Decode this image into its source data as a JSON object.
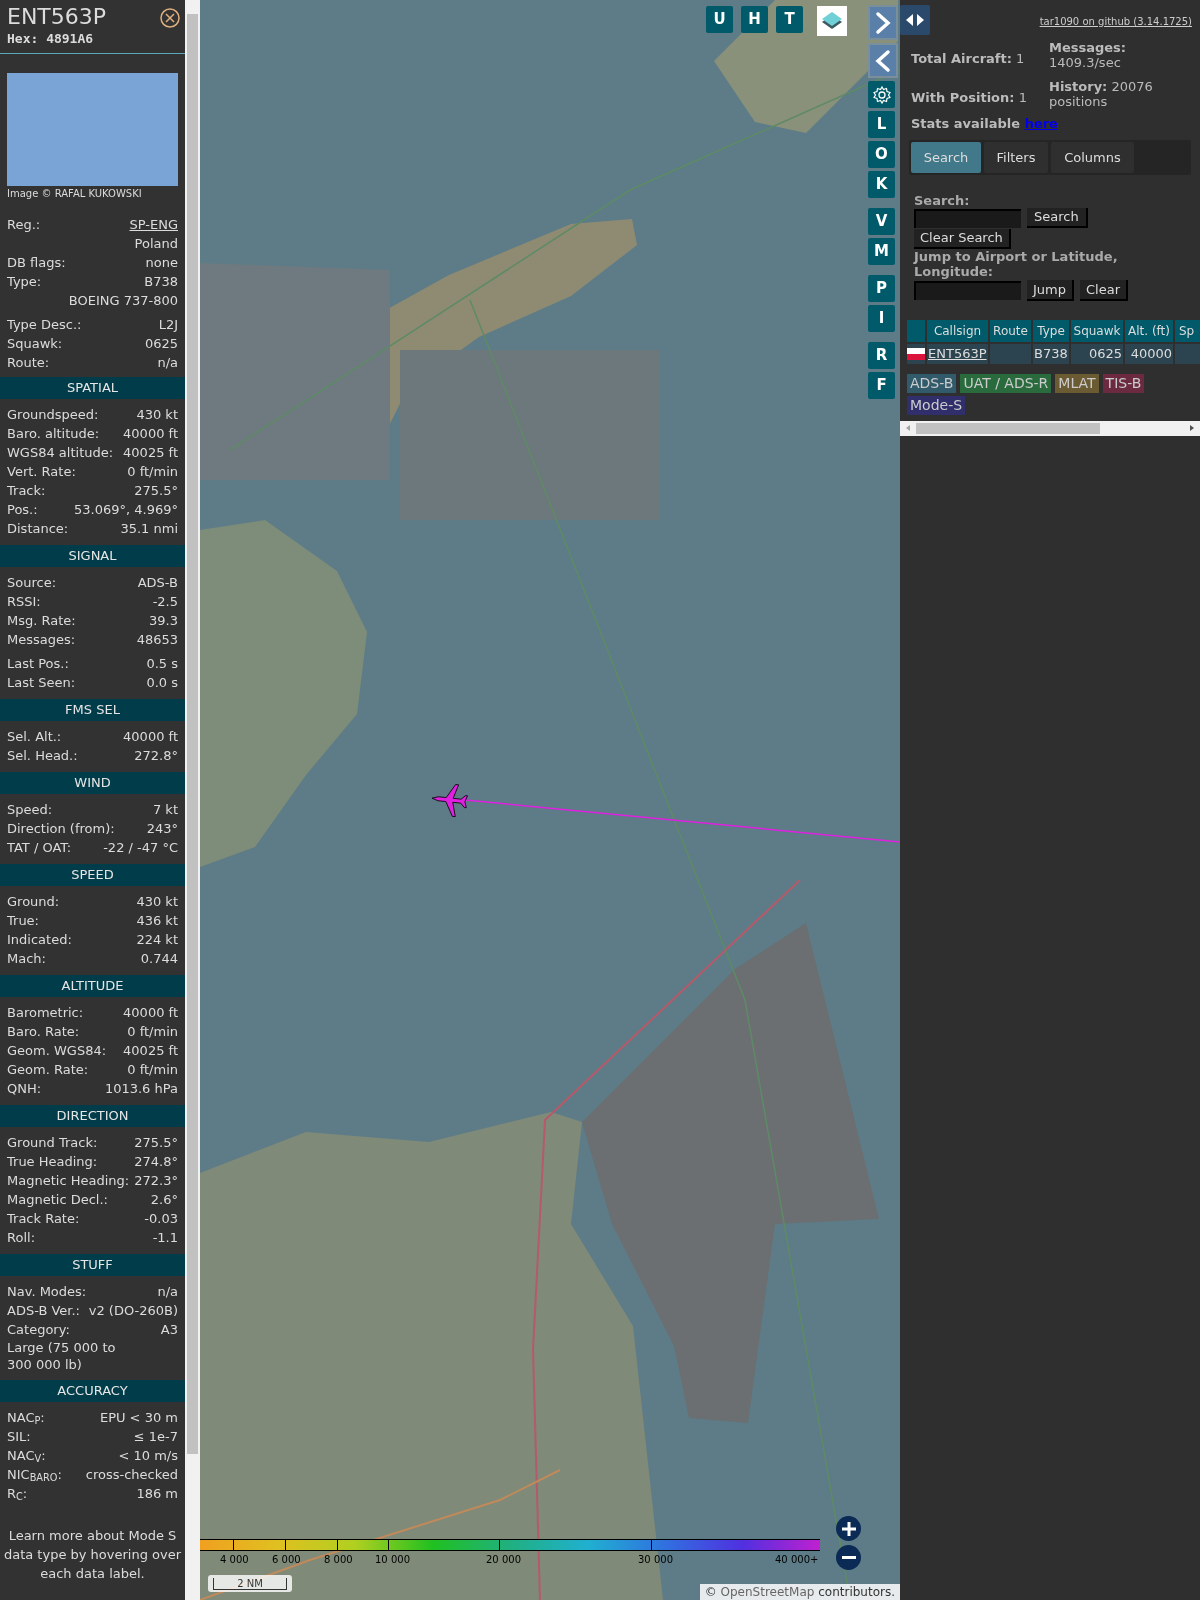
{
  "detail_panel": {
    "callsign": "ENT563P",
    "hex": "Hex: 4891A6",
    "photo_credit": "Image © RAFAL KUKOWSKI",
    "groups": [
      [
        {
          "kind": "link",
          "label": "Reg.:",
          "value": "SP-ENG"
        },
        {
          "kind": "value",
          "value": "Poland"
        },
        {
          "kind": "pair",
          "label": "DB flags:",
          "value": "none"
        },
        {
          "kind": "pair",
          "label": "Type:",
          "value": "B738"
        },
        {
          "kind": "value",
          "value": "BOEING 737-800"
        }
      ],
      [
        {
          "kind": "pair",
          "label": "Type Desc.:",
          "value": "L2J"
        },
        {
          "kind": "pair",
          "label": "Squawk:",
          "value": "0625"
        },
        {
          "kind": "pair",
          "label": "Route:",
          "value": "n/a"
        }
      ]
    ],
    "sections": [
      {
        "title": "SPATIAL",
        "groups": [
          [
            {
              "kind": "pair",
              "label": "Groundspeed:",
              "value": "430 kt"
            },
            {
              "kind": "pair",
              "label": "Baro. altitude:",
              "value": "40000 ft"
            },
            {
              "kind": "pair",
              "label": "WGS84 altitude:",
              "value": "40025 ft"
            },
            {
              "kind": "pair",
              "label": "Vert. Rate:",
              "value": "0 ft/min"
            },
            {
              "kind": "pair",
              "label": "Track:",
              "value": "275.5°"
            },
            {
              "kind": "pair",
              "label": "Pos.:",
              "value": "53.069°, 4.969°"
            },
            {
              "kind": "pair",
              "label": "Distance:",
              "value": "35.1 nmi"
            }
          ]
        ]
      },
      {
        "title": "SIGNAL",
        "groups": [
          [
            {
              "kind": "pair",
              "label": "Source:",
              "value": "ADS-B"
            },
            {
              "kind": "pair",
              "label": "RSSI:",
              "value": "-2.5"
            },
            {
              "kind": "pair",
              "label": "Msg. Rate:",
              "value": "39.3"
            },
            {
              "kind": "pair",
              "label": "Messages:",
              "value": "48653"
            }
          ],
          [
            {
              "kind": "pair",
              "label": "Last Pos.:",
              "value": "0.5 s"
            },
            {
              "kind": "pair",
              "label": "Last Seen:",
              "value": "0.0 s"
            }
          ]
        ]
      },
      {
        "title": "FMS SEL",
        "groups": [
          [
            {
              "kind": "pair",
              "label": "Sel. Alt.:",
              "value": "40000 ft"
            },
            {
              "kind": "pair",
              "label": "Sel. Head.:",
              "value": "272.8°"
            }
          ]
        ]
      },
      {
        "title": "WIND",
        "groups": [
          [
            {
              "kind": "pair",
              "label": "Speed:",
              "value": "7 kt"
            },
            {
              "kind": "pair",
              "label": "Direction (from):",
              "value": "243°"
            },
            {
              "kind": "pair",
              "label": "TAT / OAT:",
              "value": "-22 / -47 °C"
            }
          ]
        ]
      },
      {
        "title": "SPEED",
        "groups": [
          [
            {
              "kind": "pair",
              "label": "Ground:",
              "value": "430 kt"
            },
            {
              "kind": "pair",
              "label": "True:",
              "value": "436 kt"
            },
            {
              "kind": "pair",
              "label": "Indicated:",
              "value": "224 kt"
            },
            {
              "kind": "pair",
              "label": "Mach:",
              "value": "0.744"
            }
          ]
        ]
      },
      {
        "title": "ALTITUDE",
        "groups": [
          [
            {
              "kind": "pair",
              "label": "Barometric:",
              "value": "40000 ft"
            },
            {
              "kind": "pair",
              "label": "Baro. Rate:",
              "value": "0 ft/min"
            },
            {
              "kind": "pair",
              "label": "Geom. WGS84:",
              "value": "40025 ft"
            },
            {
              "kind": "pair",
              "label": "Geom. Rate:",
              "value": "0 ft/min"
            },
            {
              "kind": "pair",
              "label": "QNH:",
              "value": "1013.6 hPa"
            }
          ]
        ]
      },
      {
        "title": "DIRECTION",
        "groups": [
          [
            {
              "kind": "pair",
              "label": "Ground Track:",
              "value": "275.5°"
            },
            {
              "kind": "pair",
              "label": "True Heading:",
              "value": "274.8°"
            },
            {
              "kind": "pair",
              "label": "Magnetic Heading:",
              "value": "272.3°"
            },
            {
              "kind": "pair",
              "label": "Magnetic Decl.:",
              "value": "2.6°"
            },
            {
              "kind": "pair",
              "label": "Track Rate:",
              "value": "-0.03"
            },
            {
              "kind": "pair",
              "label": "Roll:",
              "value": "-1.1"
            }
          ]
        ]
      },
      {
        "title": "STUFF",
        "groups": [
          [
            {
              "kind": "pair",
              "label": "Nav. Modes:",
              "value": "n/a"
            },
            {
              "kind": "pair",
              "label": "ADS-B Ver.:",
              "value": "v2 (DO-260B)"
            },
            {
              "kind": "pair",
              "label": "Category:",
              "value": "A3"
            },
            {
              "kind": "text",
              "value": "Large (75 000 to 300 000 lb)"
            }
          ]
        ]
      },
      {
        "title": "ACCURACY",
        "groups": [
          [
            {
              "kind": "pair",
              "label": "NAC$_{P}$:",
              "value": "EPU < 30 m"
            },
            {
              "kind": "pair",
              "label": "SIL:",
              "value": "≤ 1e-7"
            },
            {
              "kind": "pair",
              "label": "NAC$_{V}$:",
              "value": "< 10 m/s"
            },
            {
              "kind": "pair",
              "label": "NIC$_{BARO}$:",
              "value": "cross-checked"
            },
            {
              "kind": "pair",
              "label": "R$_{C}$:",
              "value": "186 m"
            }
          ]
        ]
      }
    ],
    "footer_note": "Learn more about Mode S data type by hovering over each data label."
  },
  "map": {
    "top_buttons": [
      {
        "kind": "letter",
        "label": "U"
      },
      {
        "kind": "letter",
        "label": "H"
      },
      {
        "kind": "letter",
        "label": "T"
      },
      {
        "kind": "layers"
      }
    ],
    "side_button_groups": [
      [
        {
          "kind": "next"
        },
        {
          "kind": "prev"
        },
        {
          "kind": "settings"
        },
        {
          "kind": "letter",
          "label": "L"
        },
        {
          "kind": "letter",
          "label": "O"
        },
        {
          "kind": "letter",
          "label": "K"
        }
      ],
      [
        {
          "kind": "letter",
          "label": "V"
        },
        {
          "kind": "letter",
          "label": "M"
        }
      ],
      [
        {
          "kind": "letter",
          "label": "P"
        },
        {
          "kind": "letter",
          "label": "I"
        }
      ],
      [
        {
          "kind": "letter",
          "label": "R"
        },
        {
          "kind": "letter",
          "label": "F"
        }
      ]
    ],
    "altitude_legend": [
      "4 000",
      "6 000",
      "8 000",
      "10 000",
      "20 000",
      "30 000",
      "40 000+"
    ],
    "scale": "2 NM",
    "attribution": {
      "prefix": "©",
      "link": "OpenStreetMap",
      "suffix": "contributors."
    }
  },
  "sidebar": {
    "version_link": "tar1090 on github (3.14.1725)",
    "stats": [
      {
        "label": "Total Aircraft:",
        "value": "1"
      },
      {
        "label": "Messages:",
        "value": "1409.3/sec"
      },
      {
        "label": "With Position:",
        "value": "1"
      },
      {
        "label": "History:",
        "value": "20076 positions"
      }
    ],
    "stats_note": "Stats available",
    "stats_link": "here",
    "tabs": [
      {
        "label": "Search",
        "selected": true
      },
      {
        "label": "Filters",
        "selected": false
      },
      {
        "label": "Columns",
        "selected": false
      }
    ],
    "search": {
      "label": "Search:",
      "button": "Search",
      "clear_button": "Clear Search",
      "jump_label": "Jump to Airport or Latitude, Longitude:",
      "jump_button": "Jump",
      "jump_clear_button": "Clear"
    },
    "table": {
      "columns": [
        "Callsign",
        "Route",
        "Type",
        "Squawk",
        "Alt. (ft)",
        "Sp"
      ],
      "rows": [
        {
          "callsign": "ENT563P",
          "type": "B738",
          "squawk": "0625",
          "altitude": "40000"
        }
      ]
    },
    "source_legend": [
      {
        "label": "ADS-B",
        "color": "#315a6b"
      },
      {
        "label": "UAT / ADS-R",
        "color": "#2a6b3e"
      },
      {
        "label": "MLAT",
        "color": "#6b5b33"
      },
      {
        "label": "TIS-B",
        "color": "#6b2a3f"
      },
      {
        "label": "Mode-S",
        "color": "#302f6b"
      }
    ]
  }
}
